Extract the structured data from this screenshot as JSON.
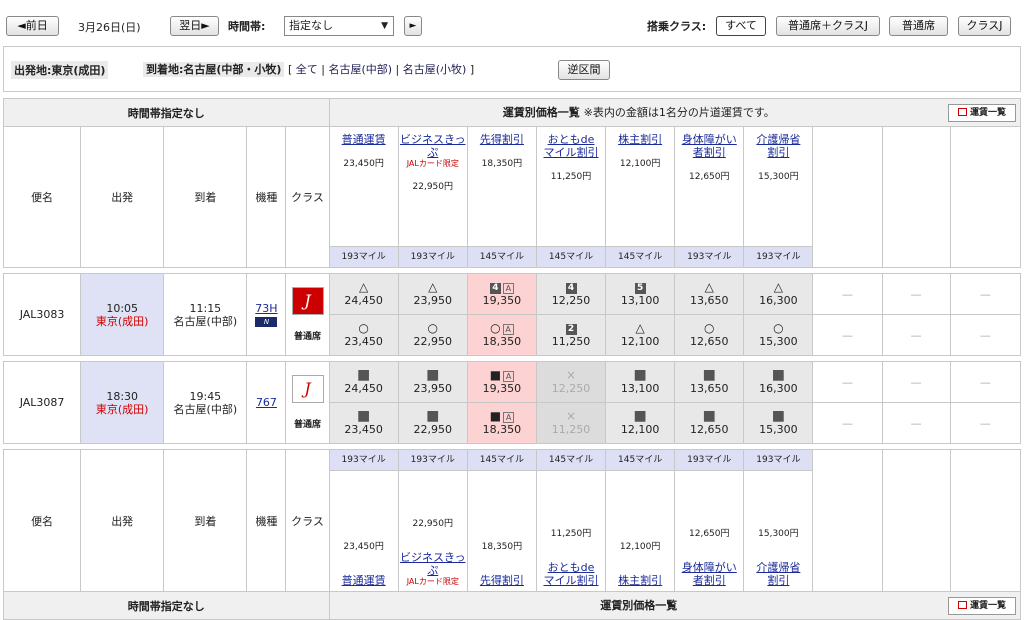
{
  "nav": {
    "prev": "◄前日",
    "date": "3月26日(日)",
    "next": "翌日►",
    "time_label": "時間帯:",
    "time_value": "指定なし",
    "go": "►"
  },
  "class_filter": {
    "label": "搭乗クラス:",
    "options": [
      "すべて",
      "普通席＋クラスJ",
      "普通席",
      "クラスJ"
    ]
  },
  "route": {
    "origin": "出発地:東京(成田)",
    "dest_label": "到着地:名古屋(中部・小牧)",
    "dest_open": "[",
    "dest_all": "全て",
    "dest_chubu": "名古屋(中部)",
    "dest_komaki": "名古屋(小牧)",
    "dest_close": "]",
    "reverse": "逆区間"
  },
  "table": {
    "time_header": "時間帯指定なし",
    "fare_header": "運賃別価格一覧",
    "fare_note": "※表内の金額は1名分の片道運賃です。",
    "fare_list_btn": "運賃一覧",
    "cols": {
      "flight": "便名",
      "dep": "出発",
      "arr": "到着",
      "aircraft": "機種",
      "class": "クラス"
    },
    "fares": [
      {
        "l1": "普通運賃",
        "l2": "",
        "sub": "",
        "price": "23,450円",
        "miles": "193マイル"
      },
      {
        "l1": "ビジネスきっぷ",
        "l2": "",
        "sub": "JALカード限定",
        "price": "22,950円",
        "miles": "193マイル"
      },
      {
        "l1": "先得割引",
        "l2": "",
        "sub": "",
        "price": "18,350円",
        "miles": "145マイル"
      },
      {
        "l1": "おともde",
        "l2": "マイル割引",
        "sub": "",
        "price": "11,250円",
        "miles": "145マイル"
      },
      {
        "l1": "株主割引",
        "l2": "",
        "sub": "",
        "price": "12,100円",
        "miles": "145マイル"
      },
      {
        "l1": "身体障がい",
        "l2": "者割引",
        "sub": "",
        "price": "12,650円",
        "miles": "193マイル"
      },
      {
        "l1": "介護帰省",
        "l2": "割引",
        "sub": "",
        "price": "15,300円",
        "miles": "193マイル"
      }
    ],
    "dash": "—",
    "seat_class": "普通席",
    "flights": [
      {
        "no": "JAL3083",
        "dep_time": "10:05",
        "dep_airport": "東京(成田)",
        "arr_time": "11:15",
        "arr_airport": "名古屋(中部)",
        "aircraft": "73H",
        "row1": [
          {
            "sym": "△",
            "val": "24,450"
          },
          {
            "sym": "△",
            "val": "23,950"
          },
          {
            "sym": "4",
            "val": "19,350"
          },
          {
            "sym": "4",
            "val": "12,250"
          },
          {
            "sym": "5",
            "val": "13,100"
          },
          {
            "sym": "△",
            "val": "13,650"
          },
          {
            "sym": "△",
            "val": "16,300"
          }
        ],
        "row2": [
          {
            "sym": "○",
            "val": "23,450"
          },
          {
            "sym": "○",
            "val": "22,950"
          },
          {
            "sym": "○",
            "val": "18,350"
          },
          {
            "sym": "2",
            "val": "11,250"
          },
          {
            "sym": "△",
            "val": "12,100"
          },
          {
            "sym": "○",
            "val": "12,650"
          },
          {
            "sym": "○",
            "val": "15,300"
          }
        ]
      },
      {
        "no": "JAL3087",
        "dep_time": "18:30",
        "dep_airport": "東京(成田)",
        "arr_time": "19:45",
        "arr_airport": "名古屋(中部)",
        "aircraft": "767",
        "row1": [
          {
            "sym": "■",
            "val": "24,450"
          },
          {
            "sym": "■",
            "val": "23,950"
          },
          {
            "sym": "■",
            "val": "19,350"
          },
          {
            "sym": "×",
            "val": "12,250"
          },
          {
            "sym": "■",
            "val": "13,100"
          },
          {
            "sym": "■",
            "val": "13,650"
          },
          {
            "sym": "■",
            "val": "16,300"
          }
        ],
        "row2": [
          {
            "sym": "■",
            "val": "23,450"
          },
          {
            "sym": "■",
            "val": "22,950"
          },
          {
            "sym": "■",
            "val": "18,350"
          },
          {
            "sym": "×",
            "val": "11,250"
          },
          {
            "sym": "■",
            "val": "12,100"
          },
          {
            "sym": "■",
            "val": "12,650"
          },
          {
            "sym": "■",
            "val": "15,300"
          }
        ]
      }
    ]
  }
}
